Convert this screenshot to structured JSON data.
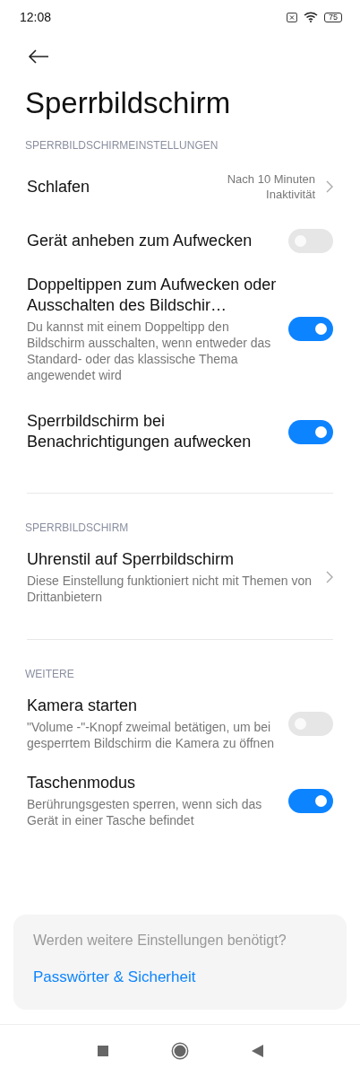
{
  "status_bar": {
    "time": "12:08",
    "battery": "75"
  },
  "title": "Sperrbildschirm",
  "sections": [
    {
      "header": "SPERRBILDSCHIRMEINSTELLUNGEN",
      "items": [
        {
          "kind": "link",
          "title": "Schlafen",
          "value": "Nach 10 Minuten Inaktivität"
        },
        {
          "kind": "toggle",
          "title": "Gerät anheben zum Aufwecken",
          "on": false
        },
        {
          "kind": "toggle",
          "title": "Doppeltippen zum Aufwecken oder Ausschalten des Bildschir…",
          "description": "Du kannst mit einem Doppeltipp den Bildschirm ausschalten, wenn entweder das Standard- oder das klassische Thema angewendet wird",
          "on": true
        },
        {
          "kind": "toggle",
          "title": "Sperrbildschirm bei Benachrichtigungen aufwecken",
          "on": true
        }
      ]
    },
    {
      "header": "SPERRBILDSCHIRM",
      "items": [
        {
          "kind": "link",
          "title": "Uhrenstil auf Sperrbildschirm",
          "description": "Diese Einstellung funktioniert nicht mit Themen von Drittanbietern"
        }
      ]
    },
    {
      "header": "WEITERE",
      "items": [
        {
          "kind": "toggle",
          "title": "Kamera starten",
          "description": "\"Volume -\"-Knopf zweimal betätigen, um bei gesperrtem Bildschirm die Kamera zu öffnen",
          "on": false
        },
        {
          "kind": "toggle",
          "title": "Taschenmodus",
          "description": "Berührungsgesten sperren, wenn sich das Gerät in einer Tasche befindet",
          "on": true
        }
      ]
    }
  ],
  "suggestion": {
    "question": "Werden weitere Einstellungen benötigt?",
    "link": "Passwörter & Sicherheit"
  }
}
